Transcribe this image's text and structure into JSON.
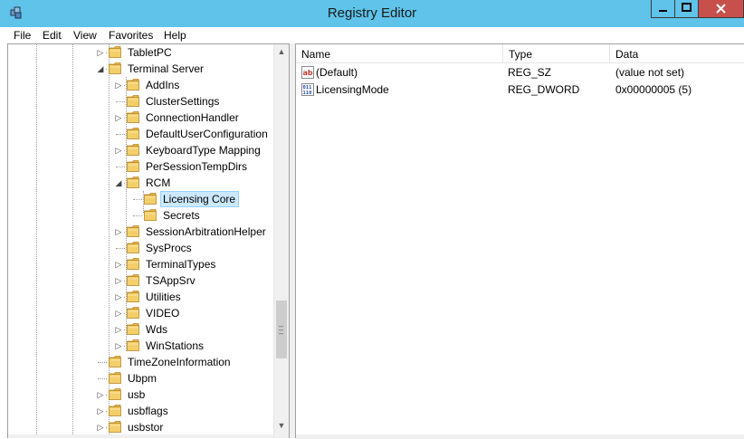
{
  "window": {
    "title": "Registry Editor"
  },
  "title_icons": [
    "registry-editor-icon",
    "minimize-icon",
    "maximize-icon",
    "close-icon"
  ],
  "menu": [
    "File",
    "Edit",
    "View",
    "Favorites",
    "Help"
  ],
  "tree": {
    "nodes": [
      {
        "label": "TabletPC",
        "expander": "collapsed"
      },
      {
        "label": "Terminal Server",
        "expander": "expanded"
      },
      {
        "label": "AddIns",
        "expander": "collapsed"
      },
      {
        "label": "ClusterSettings",
        "expander": "none"
      },
      {
        "label": "ConnectionHandler",
        "expander": "collapsed"
      },
      {
        "label": "DefaultUserConfiguration",
        "expander": "none"
      },
      {
        "label": "KeyboardType Mapping",
        "expander": "collapsed"
      },
      {
        "label": "PerSessionTempDirs",
        "expander": "none"
      },
      {
        "label": "RCM",
        "expander": "expanded"
      },
      {
        "label": "Licensing Core",
        "expander": "none",
        "selected": true
      },
      {
        "label": "Secrets",
        "expander": "none"
      },
      {
        "label": "SessionArbitrationHelper",
        "expander": "collapsed"
      },
      {
        "label": "SysProcs",
        "expander": "none"
      },
      {
        "label": "TerminalTypes",
        "expander": "collapsed"
      },
      {
        "label": "TSAppSrv",
        "expander": "collapsed"
      },
      {
        "label": "Utilities",
        "expander": "collapsed"
      },
      {
        "label": "VIDEO",
        "expander": "collapsed"
      },
      {
        "label": "Wds",
        "expander": "collapsed"
      },
      {
        "label": "WinStations",
        "expander": "collapsed"
      },
      {
        "label": "TimeZoneInformation",
        "expander": "none"
      },
      {
        "label": "Ubpm",
        "expander": "none"
      },
      {
        "label": "usb",
        "expander": "collapsed"
      },
      {
        "label": "usbflags",
        "expander": "collapsed"
      },
      {
        "label": "usbstor",
        "expander": "collapsed"
      }
    ]
  },
  "values_list": {
    "columns": [
      "Name",
      "Type",
      "Data"
    ],
    "rows": [
      {
        "icon": "string-value-icon",
        "name": "(Default)",
        "type": "REG_SZ",
        "data": "(value not set)"
      },
      {
        "icon": "dword-value-icon",
        "name": "LicensingMode",
        "type": "REG_DWORD",
        "data": "0x00000005 (5)"
      }
    ]
  },
  "colors": {
    "titlebar": "#5fc3ea",
    "close_button": "#c7504c",
    "selection": "#cce8ff",
    "selection_border": "#99d1ff"
  }
}
